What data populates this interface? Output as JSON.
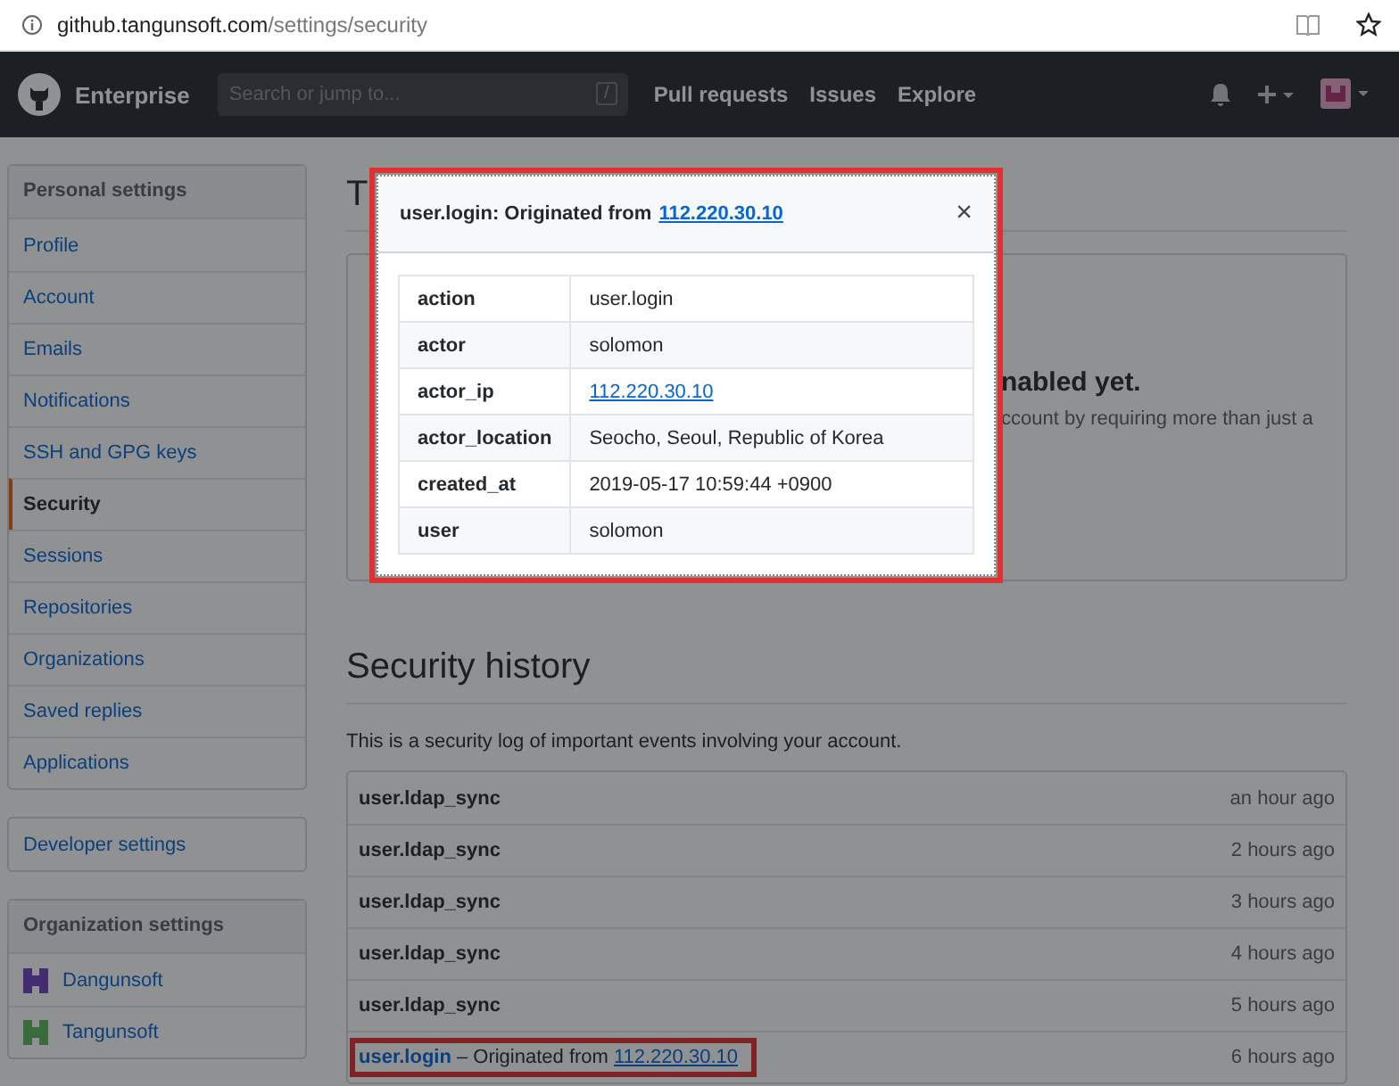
{
  "address_bar": {
    "host": "github.tangunsoft.com",
    "path": "/settings/security"
  },
  "header": {
    "brand": "Enterprise",
    "search": {
      "placeholder": "Search or jump to...",
      "key": "/"
    },
    "nav": [
      "Pull requests",
      "Issues",
      "Explore"
    ]
  },
  "sidebar": {
    "title": "Personal settings",
    "items": [
      {
        "label": "Profile",
        "selected": false
      },
      {
        "label": "Account",
        "selected": false
      },
      {
        "label": "Emails",
        "selected": false
      },
      {
        "label": "Notifications",
        "selected": false
      },
      {
        "label": "SSH and GPG keys",
        "selected": false
      },
      {
        "label": "Security",
        "selected": true
      },
      {
        "label": "Sessions",
        "selected": false
      },
      {
        "label": "Repositories",
        "selected": false
      },
      {
        "label": "Organizations",
        "selected": false
      },
      {
        "label": "Saved replies",
        "selected": false
      },
      {
        "label": "Applications",
        "selected": false
      }
    ],
    "developer": "Developer settings",
    "org_title": "Organization settings",
    "orgs": [
      {
        "name": "Dangunsoft"
      },
      {
        "name": "Tangunsoft"
      }
    ]
  },
  "two_factor": {
    "title": "T",
    "heading": "nabled yet.",
    "text": "ccount by requiring more than just a"
  },
  "history": {
    "title": "Security history",
    "description": "This is a security log of important events involving your account.",
    "rows": [
      {
        "kind": "event",
        "action": "user.ldap_sync",
        "time": "an hour ago",
        "highlighted": false
      },
      {
        "kind": "event",
        "action": "user.ldap_sync",
        "time": "2 hours ago",
        "highlighted": false
      },
      {
        "kind": "event",
        "action": "user.ldap_sync",
        "time": "3 hours ago",
        "highlighted": false
      },
      {
        "kind": "event",
        "action": "user.ldap_sync",
        "time": "4 hours ago",
        "highlighted": false
      },
      {
        "kind": "event",
        "action": "user.ldap_sync",
        "time": "5 hours ago",
        "highlighted": false
      },
      {
        "kind": "login",
        "action": "user.login",
        "origin": "– Originated from",
        "ip": "112.220.30.10",
        "time": "6 hours ago",
        "highlighted": true
      }
    ]
  },
  "modal": {
    "highlighted": true,
    "title": "user.login: Originated from",
    "ip": "112.220.30.10",
    "close": "×",
    "fields": [
      {
        "key": "action",
        "value": "user.login",
        "kind": "text"
      },
      {
        "key": "actor",
        "value": "solomon",
        "kind": "text"
      },
      {
        "key": "actor_ip",
        "value": "112.220.30.10",
        "kind": "link"
      },
      {
        "key": "actor_location",
        "value": "Seocho, Seoul, Republic of Korea",
        "kind": "text"
      },
      {
        "key": "created_at",
        "value": "2019-05-17 10:59:44 +0900",
        "kind": "text"
      },
      {
        "key": "user",
        "value": "solomon",
        "kind": "text"
      }
    ]
  }
}
